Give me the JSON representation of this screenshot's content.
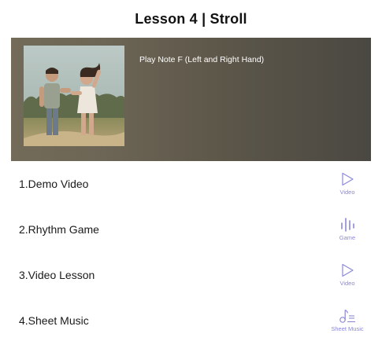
{
  "header": {
    "title": "Lesson 4 | Stroll"
  },
  "hero": {
    "subtitle": "Play Note F (Left and Right Hand)",
    "thumbnail_icon": "couple-walking-photo"
  },
  "items": [
    {
      "label": "1.Demo Video",
      "action_label": "Video",
      "action_icon": "play-icon"
    },
    {
      "label": "2.Rhythm Game",
      "action_label": "Game",
      "action_icon": "rhythm-bars-icon"
    },
    {
      "label": "3.Video Lesson",
      "action_label": "Video",
      "action_icon": "play-icon"
    },
    {
      "label": "4.Sheet Music",
      "action_label": "Sheet Music",
      "action_icon": "music-note-icon"
    }
  ],
  "colors": {
    "accent": "#8c88d8",
    "text": "#1a1a1a"
  }
}
